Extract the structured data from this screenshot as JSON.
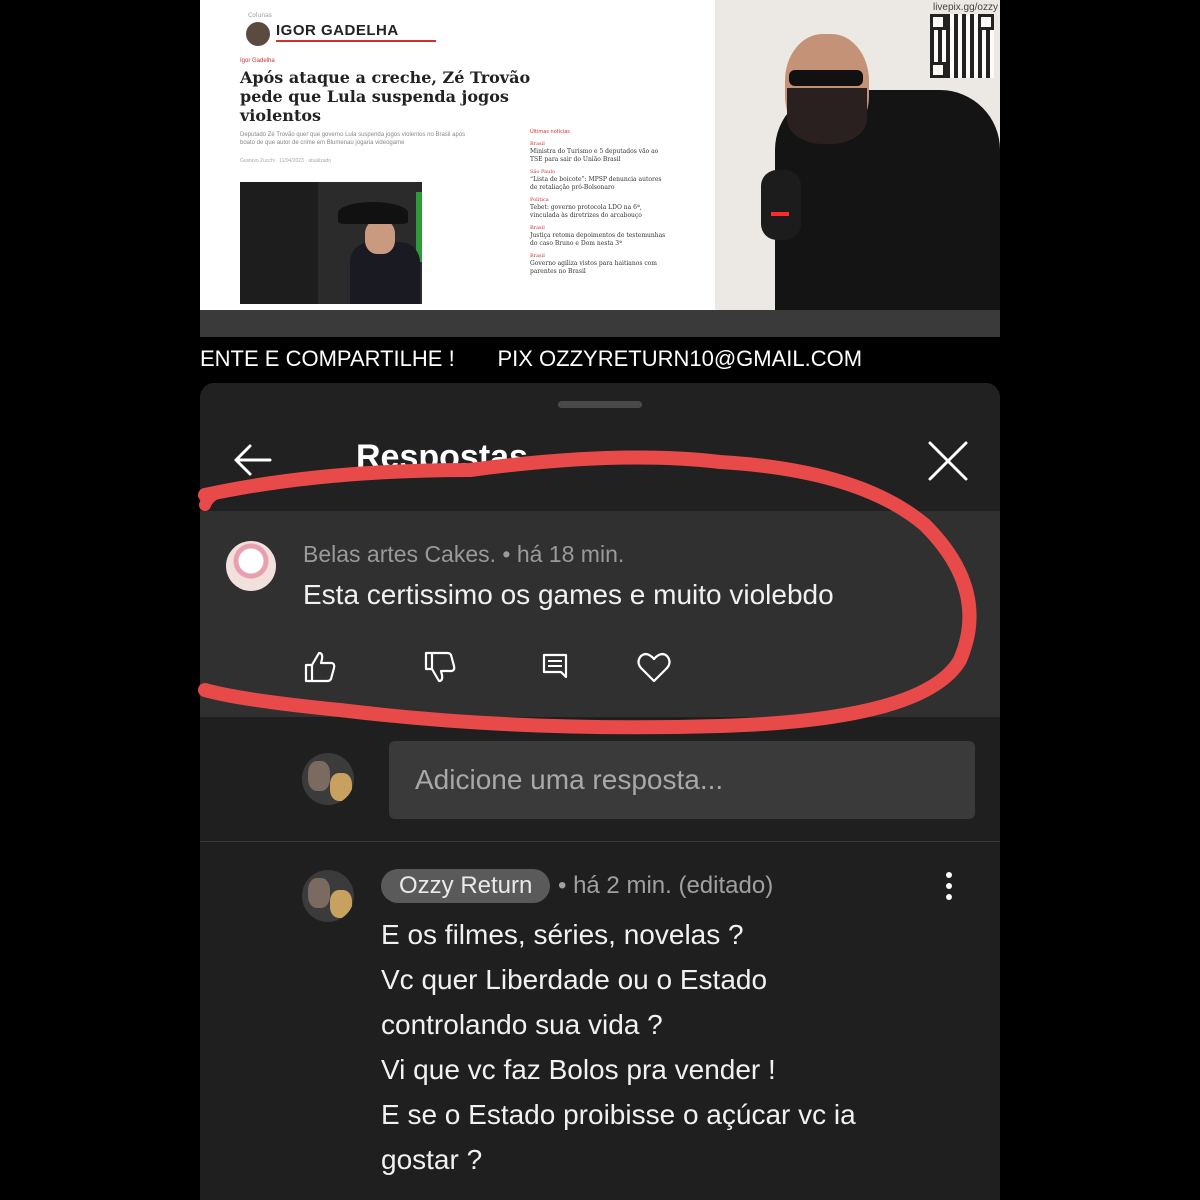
{
  "video": {
    "article": {
      "column_tag": "Colunas",
      "author": "IGOR GADELHA",
      "byline": "Igor Gadelha",
      "headline": "Após ataque a creche, Zé Trovão pede que Lula suspenda jogos violentos",
      "lede": "Deputado Zé Trovão quer que governo Lula suspenda jogos violentos no Brasil após boato de que autor de crime em Blumenau jogaria videogame",
      "meta": "Gustavo Zucchi · 11/04/2023 · atualizado",
      "sidebar_header": "Últimas notícias",
      "sidebar": [
        {
          "section": "Brasil",
          "text": "Ministra do Turismo e 5 deputados vão ao TSE para sair do União Brasil"
        },
        {
          "section": "São Paulo",
          "text": "“Lista de boicote”: MPSP denuncia autores de retaliação pró-Bolsonaro"
        },
        {
          "section": "Política",
          "text": "Tebet: governo protocola LDO na 6ª, vinculada às diretrizes do arcabouço"
        },
        {
          "section": "Brasil",
          "text": "Justiça retoma depoimentos de testemunhas do caso Bruno e Dom nesta 3ª"
        },
        {
          "section": "Brasil",
          "text": "Governo agiliza vistos para haitianos com parentes no Brasil"
        }
      ]
    },
    "livepix": "livepix.gg/ozzy"
  },
  "ticker": {
    "text": "ENTE E COMPARTILHE !       PIX OZZYRETURN10@GMAIL.COM"
  },
  "panel": {
    "title": "Respostas",
    "parent_comment": {
      "author": "Belas artes Cakes.",
      "time": "há 18 min.",
      "meta": "Belas artes Cakes. • há 18 min.",
      "text": "Esta certissimo os games e muito violebdo"
    },
    "reply_input": {
      "placeholder": "Adicione uma resposta..."
    },
    "reply": {
      "author": "Ozzy Return",
      "meta": "• há 2 min. (editado)",
      "lines": [
        "E os filmes, séries, novelas ?",
        "Vc quer Liberdade ou o Estado",
        "controlando sua vida ?",
        "Vi que vc faz Bolos pra vender !",
        "E se o Estado proibisse o açúcar vc ia",
        "gostar ?"
      ]
    },
    "icons": {
      "back": "arrow-left-icon",
      "close": "close-icon",
      "like": "thumbs-up-icon",
      "dislike": "thumbs-down-icon",
      "reply": "comment-icon",
      "heart": "heart-icon",
      "more": "more-vertical-icon"
    }
  },
  "annotation": {
    "color": "#e84a4a"
  }
}
